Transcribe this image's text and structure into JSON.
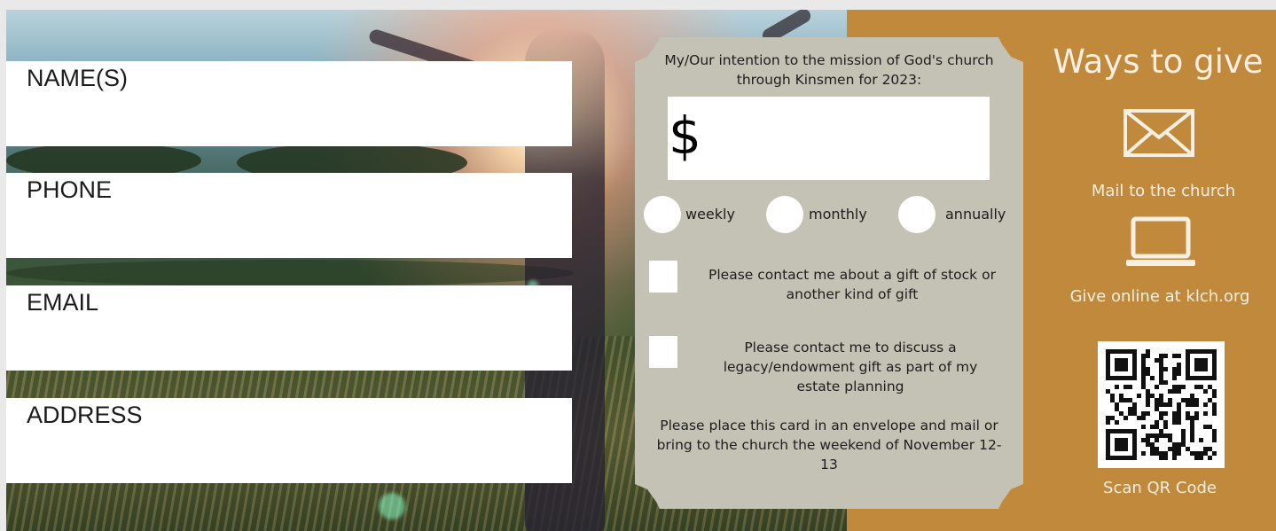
{
  "fields": {
    "name_label": "NAME(S)",
    "phone_label": "PHONE",
    "email_label": "EMAIL",
    "address_label": "ADDRESS"
  },
  "pledge": {
    "intro": "My/Our intention to the mission of God's church through Kinsmen for 2023:",
    "currency_symbol": "$",
    "frequency_options": [
      "weekly",
      "monthly",
      "annually"
    ],
    "checkbox_stock": "Please contact me about a gift of stock or another kind of gift",
    "checkbox_legacy": "Please contact me to discuss a legacy/endowment gift as part of my estate planning",
    "instructions": "Please place this card in an envelope and mail or bring to the church the weekend of November 12-13"
  },
  "ways_to_give": {
    "title": "Ways to give",
    "mail_icon": "envelope-icon",
    "mail_text": "Mail to the church",
    "online_icon": "laptop-icon",
    "online_text": "Give online at klch.org",
    "qr_icon": "qr-code",
    "qr_text": "Scan QR Code"
  },
  "colors": {
    "panel": "#c0893b",
    "card": "#c4c2b5",
    "field": "#ffffff"
  }
}
